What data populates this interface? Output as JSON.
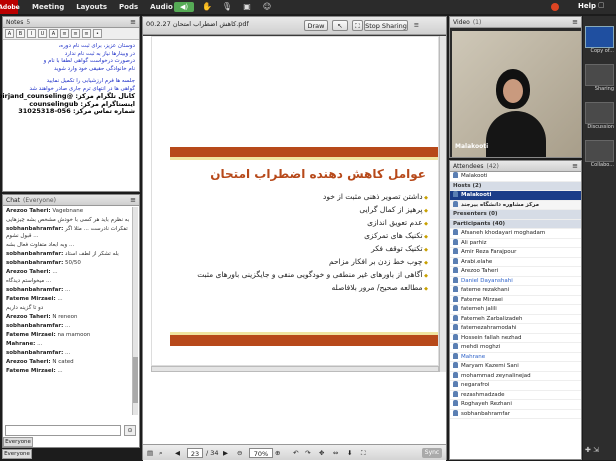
{
  "topbar": {
    "logo": "Adobe",
    "menus": [
      "Meeting",
      "Layouts",
      "Pods",
      "Audio"
    ],
    "help": "Help"
  },
  "notes": {
    "title": "Notes",
    "count": "5",
    "lines": [
      "دوستان عزیز، برای ثبت نام دوره،",
      "در وبینارها نیاز به ثبت نام ندارد",
      "درصورت درخواست گواهی لطفا با نام و",
      "نام خانوادگی حقیقی خود وارد شوید",
      "",
      "جلسه ها فرم ارزشیابی را تکمیل نمایید",
      "گواهی ها در انتهای ترم جاری صادر خواهند شد",
      "کانال تلگرام مرکز: @birjand_counseling",
      "اینستاگرام مرکز: counselingub",
      "شماره تماس مرکز: 056-31025318"
    ]
  },
  "chat": {
    "title": "Chat",
    "scope": "(Everyone)",
    "tab": "Everyone",
    "messages": [
      {
        "name": "Arezoo Taheri:",
        "text": "Vagebnane"
      },
      {
        "name": "",
        "text": "به نظرم باید هر کسی با خودش مشخص بشه چیزهایی"
      },
      {
        "name": "sobhanbahramfar:",
        "text": "تفکرات نادرست ... مثلا اگر قبول نشوم ..."
      },
      {
        "name": "",
        "text": "وبه ابعاد متفاوت فعال بشه ..."
      },
      {
        "name": "sobhanbahramfar:",
        "text": "بله تشکر از لطف استاد"
      },
      {
        "name": "sobhanbahramfar:",
        "text": "50/50"
      },
      {
        "name": "Arezoo Taheri:",
        "text": "..."
      },
      {
        "name": "",
        "text": "میخواستم دیدگاه ..."
      },
      {
        "name": "sobhanbahramfar:",
        "text": "..."
      },
      {
        "name": "Fateme Mirzaei:",
        "text": "..."
      },
      {
        "name": "",
        "text": "دو تا گزینه داریم"
      },
      {
        "name": "Arezoo Taheri:",
        "text": "N reneon"
      },
      {
        "name": "sobhanbahramfar:",
        "text": "..."
      },
      {
        "name": "Fateme Mirzaei:",
        "text": "na mamoon"
      },
      {
        "name": "Mahrane:",
        "text": "..."
      },
      {
        "name": "sobhanbahramfar:",
        "text": "..."
      },
      {
        "name": "Arezoo Taheri:",
        "text": "N cated"
      },
      {
        "name": "Fateme Mirzaei:",
        "text": "..."
      }
    ]
  },
  "share": {
    "title": "00.2.27 کاهش اضطراب امتحان.pdf",
    "draw_label": "Draw",
    "stop_label": "Stop Sharing",
    "page": "23",
    "total": "/ 34",
    "zoom": "70%",
    "sync": "Sync"
  },
  "slide": {
    "title": "عوامل کاهش دهنده اضطراب امتحان",
    "items": [
      "داشتن تصویر ذهنی مثبت از خود",
      "پرهیز از کمال گرایی",
      "عدم تعویق اندازی",
      "تکنیک های تمرکزی",
      "تکنیک توقف فکر",
      "چوب خط زدن بر افکار مزاحم",
      "آگاهی از باورهای غیر منطقی و خودگویی منفی و جایگزینی باورهای مثبت",
      "مطالعه صحیح/ مرور بلافاصله"
    ]
  },
  "video": {
    "title": "Video",
    "count": "(1)",
    "name": "Malakooti"
  },
  "attendees": {
    "title": "Attendees",
    "count": "(42)",
    "search_name": "Malakooti",
    "hosts_label": "Hosts (2)",
    "hosts": [
      "Malakooti",
      "مرکز مشاوره دانشگاه بیرجند"
    ],
    "presenters_label": "Presenters (0)",
    "participants_label": "Participants (40)",
    "participants": [
      "Afsaneh khodayari moghadam",
      "Ali parhiz",
      "Amir Reza Farajpour",
      "Arabi.elahe",
      "Arezoo Taheri",
      "Daniel Dayanshahi",
      "fateme rezakhani",
      "Fateme Mirzaei",
      "fatemeh jalili",
      "Fatemeh Zarbalizadeh",
      "fatemezahramodahi",
      "Hossein fallah nezhad",
      "mehdi moghzi",
      "Mahrane",
      "Maryam Kazemi Sani",
      "mohammad zeynalinejad",
      "negarafroi",
      "rezashmadzade",
      "Roghayeh Rezhani",
      "sobhanbahramfar"
    ],
    "highlighted": [
      "Daniel Dayanshahi",
      "Mahrane"
    ]
  },
  "dock": {
    "items": [
      "Copy of...",
      "Sharing",
      "Discussion",
      "Collabo..."
    ]
  }
}
